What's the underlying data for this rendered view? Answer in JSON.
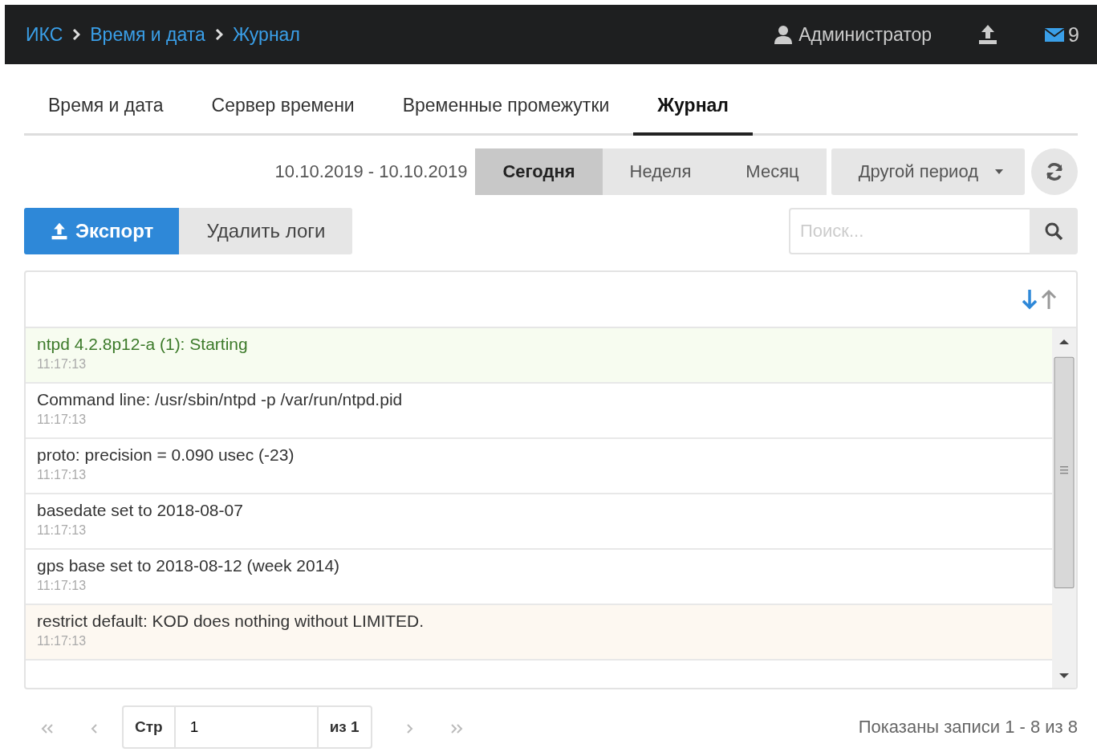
{
  "breadcrumbs": [
    "ИКС",
    "Время и дата",
    "Журнал"
  ],
  "header": {
    "user": "Администратор",
    "messages_count": "9"
  },
  "tabs": [
    {
      "label": "Время и дата",
      "selected": false
    },
    {
      "label": "Сервер времени",
      "selected": false
    },
    {
      "label": "Временные промежутки",
      "selected": false
    },
    {
      "label": "Журнал",
      "selected": true
    }
  ],
  "period": {
    "range": "10.10.2019 - 10.10.2019",
    "options": [
      {
        "label": "Сегодня",
        "selected": true
      },
      {
        "label": "Неделя",
        "selected": false
      },
      {
        "label": "Месяц",
        "selected": false
      }
    ],
    "other": "Другой период"
  },
  "actions": {
    "export": "Экспорт",
    "delete": "Удалить логи"
  },
  "search": {
    "placeholder": "Поиск..."
  },
  "log": [
    {
      "kind": "info",
      "message": "ntpd 4.2.8p12-a (1): Starting",
      "time": "11:17:13"
    },
    {
      "kind": "normal",
      "message": "Command line: /usr/sbin/ntpd -p /var/run/ntpd.pid",
      "time": "11:17:13"
    },
    {
      "kind": "normal",
      "message": "proto: precision = 0.090 usec (-23)",
      "time": "11:17:13"
    },
    {
      "kind": "normal",
      "message": "basedate set to 2018-08-07",
      "time": "11:17:13"
    },
    {
      "kind": "normal",
      "message": "gps base set to 2018-08-12 (week 2014)",
      "time": "11:17:13"
    },
    {
      "kind": "warning",
      "message": "restrict default: KOD does nothing without LIMITED.",
      "time": "11:17:13"
    }
  ],
  "pagination": {
    "page_label": "Стр",
    "page": "1",
    "of": "из 1",
    "summary": "Показаны записи 1 - 8 из 8"
  }
}
